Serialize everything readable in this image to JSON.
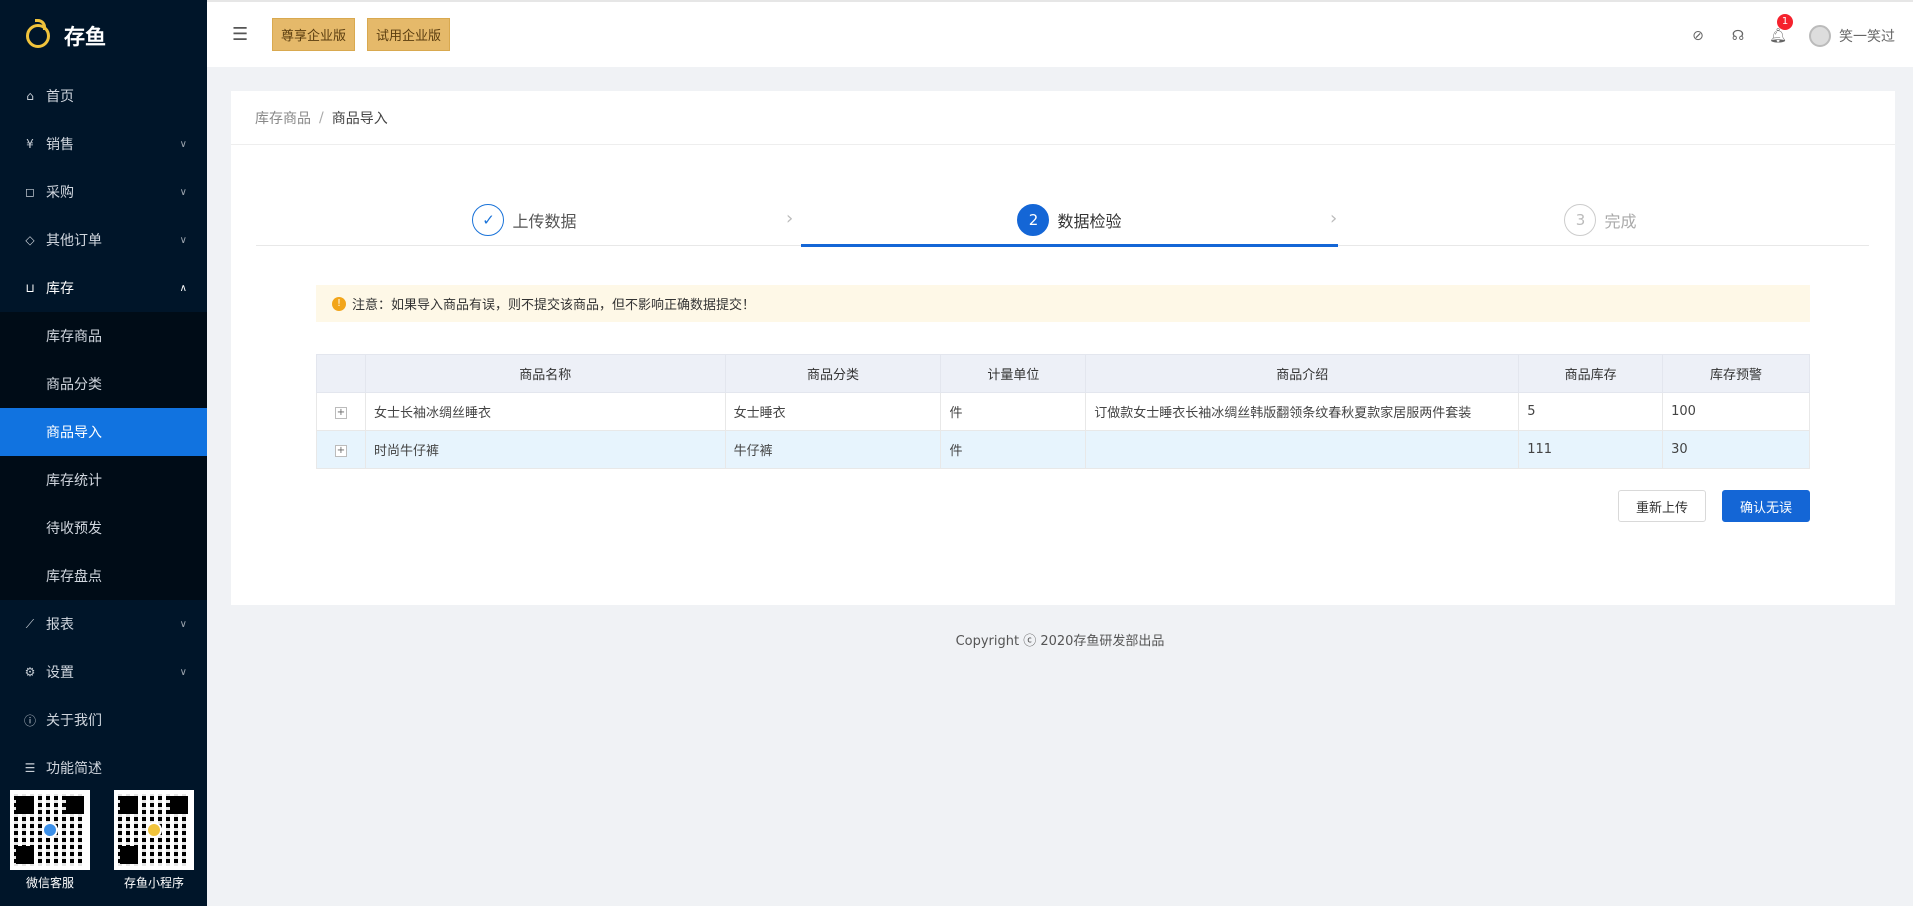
{
  "app": {
    "name": "存鱼"
  },
  "sidebar": {
    "items": [
      {
        "label": "首页",
        "icon": "home-icon"
      },
      {
        "label": "销售",
        "icon": "yen-icon"
      },
      {
        "label": "采购",
        "icon": "bag-icon"
      },
      {
        "label": "其他订单",
        "icon": "tag-icon"
      },
      {
        "label": "库存",
        "icon": "cart-icon"
      },
      {
        "label": "报表",
        "icon": "chart-icon"
      },
      {
        "label": "设置",
        "icon": "gear-icon"
      },
      {
        "label": "关于我们",
        "icon": "info-icon"
      },
      {
        "label": "功能简述",
        "icon": "list-icon"
      }
    ],
    "inventory_sub": [
      {
        "label": "库存商品"
      },
      {
        "label": "商品分类"
      },
      {
        "label": "商品导入"
      },
      {
        "label": "库存统计"
      },
      {
        "label": "待收预发"
      },
      {
        "label": "库存盘点"
      }
    ],
    "qr": [
      {
        "label": "微信客服"
      },
      {
        "label": "存鱼小程序"
      }
    ]
  },
  "header": {
    "edition_premium": "尊享企业版",
    "edition_trial": "试用企业版",
    "notification_count": "1",
    "username": "笑一笑过"
  },
  "breadcrumb": {
    "parent": "库存商品",
    "current": "商品导入"
  },
  "steps": [
    {
      "label": "上传数据",
      "status": "done",
      "number": "✓"
    },
    {
      "label": "数据检验",
      "status": "current",
      "number": "2"
    },
    {
      "label": "完成",
      "status": "wait",
      "number": "3"
    }
  ],
  "notice": "注意：如果导入商品有误，则不提交该商品，但不影响正确数据提交！",
  "table": {
    "headers": [
      "商品名称",
      "商品分类",
      "计量单位",
      "商品介绍",
      "商品库存",
      "库存预警"
    ],
    "rows": [
      [
        "女士长袖冰绸丝睡衣",
        "女士睡衣",
        "件",
        "订做款女士睡衣长袖冰绸丝韩版翻领条纹春秋夏款家居服两件套装",
        "5",
        "100"
      ],
      [
        "时尚牛仔裤",
        "牛仔裤",
        "件",
        "",
        "111",
        "30"
      ]
    ]
  },
  "buttons": {
    "reupload": "重新上传",
    "confirm": "确认无误"
  },
  "footer": "Copyright ⓒ 2020存鱼研发部出品",
  "colors": {
    "sidebar_bg": "#001529",
    "primary": "#1466d6",
    "edition_badge": "#e5b96a"
  }
}
